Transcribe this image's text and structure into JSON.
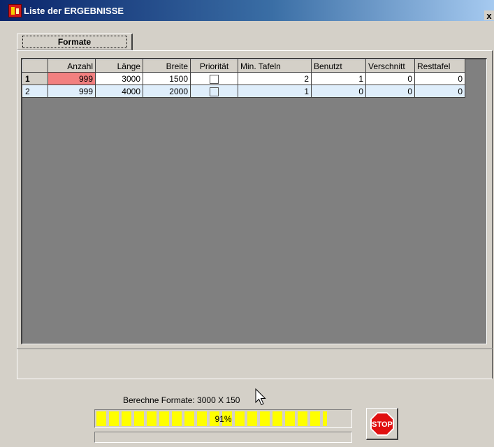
{
  "window": {
    "title": "Liste der ERGEBNISSE",
    "close_label": "x"
  },
  "tab": {
    "label": "Formate"
  },
  "table": {
    "columns": [
      "",
      "Anzahl",
      "Länge",
      "Breite",
      "Priorität",
      "Min. Tafeln",
      "Benutzt",
      "Verschnitt",
      "Resttafel"
    ],
    "rows": [
      {
        "id": "1",
        "anzahl": "999",
        "laenge": "3000",
        "breite": "1500",
        "prioritaet": false,
        "min_tafeln": "2",
        "benutzt": "1",
        "verschnitt": "0",
        "resttafel": "0"
      },
      {
        "id": "2",
        "anzahl": "999",
        "laenge": "4000",
        "breite": "2000",
        "prioritaet": false,
        "min_tafeln": "1",
        "benutzt": "0",
        "verschnitt": "0",
        "resttafel": "0"
      }
    ]
  },
  "status": {
    "text": "Berechne Formate: 3000 X 150"
  },
  "progress": {
    "value": 0.91,
    "label": "91%",
    "secondary_value": 0
  },
  "stop_button": {
    "label": "STOP",
    "color": "#e01010"
  },
  "colors": {
    "highlight_cell": "#f28080",
    "alt_row": "#dfeefb",
    "progress_fill": "#ffff00"
  }
}
